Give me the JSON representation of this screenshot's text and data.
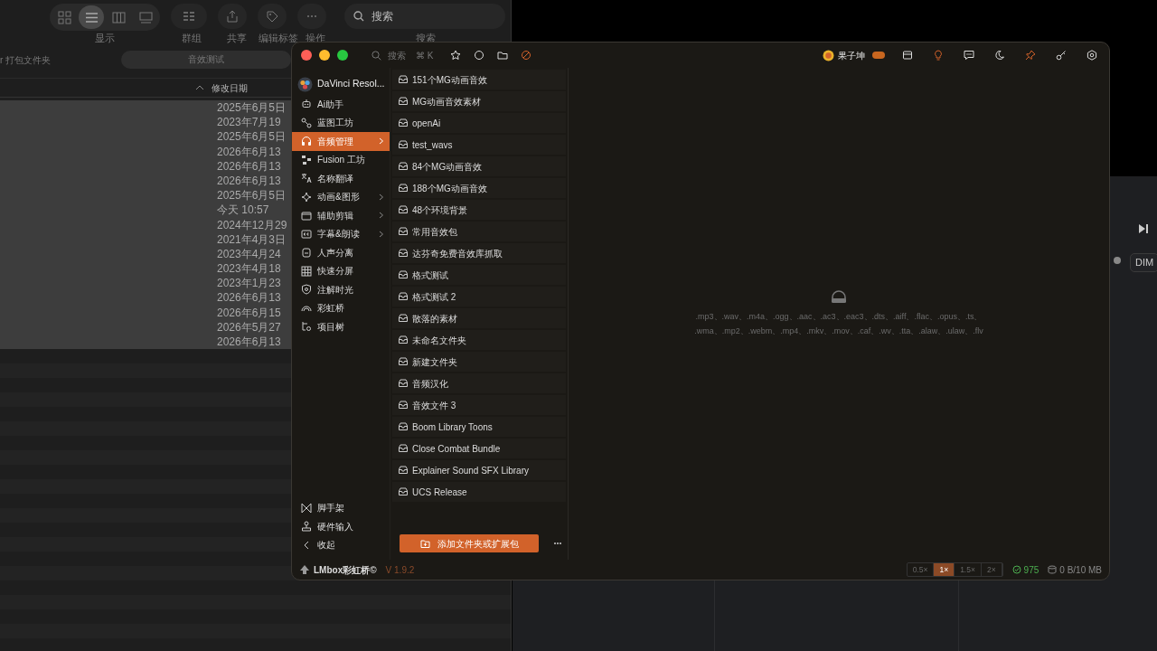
{
  "finder": {
    "view_modes": [
      {
        "selected": false
      },
      {
        "selected": true
      },
      {
        "selected": false
      },
      {
        "selected": false
      }
    ],
    "toolbar_labels": [
      "显示",
      "群组",
      "共享",
      "编辑标签",
      "操作"
    ],
    "search": {
      "placeholder": "搜索",
      "label": "搜索"
    },
    "path": {
      "crumb": "r 打包文件夹",
      "tab": "音效测试"
    },
    "column": "修改日期",
    "rows": [
      {
        "date": "2025年6月5日",
        "selected": true
      },
      {
        "date": "2023年7月19",
        "selected": true
      },
      {
        "date": "2025年6月5日",
        "selected": true
      },
      {
        "date": "2026年6月13",
        "selected": true
      },
      {
        "date": "2026年6月13",
        "selected": true
      },
      {
        "date": "2026年6月13",
        "selected": true
      },
      {
        "date": "2025年6月5日",
        "selected": true
      },
      {
        "date": "今天 10:57",
        "selected": true
      },
      {
        "date": "2024年12月29",
        "selected": true
      },
      {
        "date": "2021年4月3日",
        "selected": true
      },
      {
        "date": "2023年4月24",
        "selected": true
      },
      {
        "date": "2023年4月18",
        "selected": true
      },
      {
        "date": "2023年1月23",
        "selected": true
      },
      {
        "date": "2026年6月13",
        "selected": true
      },
      {
        "date": "2026年6月15",
        "selected": true
      },
      {
        "date": "2026年5月27",
        "selected": true
      },
      {
        "date": "2026年6月13",
        "selected": true
      }
    ]
  },
  "app": {
    "search": {
      "placeholder": "搜索",
      "shortcut": "⌘ K"
    },
    "user": {
      "name": "果子坤"
    },
    "project": "DaVinci Resol...",
    "sidebar": [
      {
        "label": "Ai助手",
        "selected": false,
        "submenu": false
      },
      {
        "label": "蓝图工坊",
        "selected": false,
        "submenu": false
      },
      {
        "label": "音频管理",
        "selected": true,
        "submenu": true
      },
      {
        "label": "Fusion 工坊",
        "selected": false,
        "submenu": false
      },
      {
        "label": "名称翻译",
        "selected": false,
        "submenu": false
      },
      {
        "label": "动画&图形",
        "selected": false,
        "submenu": true
      },
      {
        "label": "辅助剪辑",
        "selected": false,
        "submenu": true
      },
      {
        "label": "字幕&朗读",
        "selected": false,
        "submenu": true
      },
      {
        "label": "人声分离",
        "selected": false,
        "submenu": false
      },
      {
        "label": "快速分屏",
        "selected": false,
        "submenu": false
      },
      {
        "label": "注解时光",
        "selected": false,
        "submenu": false
      },
      {
        "label": "彩虹桥",
        "selected": false,
        "submenu": false
      },
      {
        "label": "项目树",
        "selected": false,
        "submenu": false
      }
    ],
    "sidebar_bottom": [
      "脚手架",
      "硬件输入",
      "收起"
    ],
    "folders": [
      "151个MG动画音效",
      "MG动画音效素材",
      "openAi",
      "test_wavs",
      "84个MG动画音效",
      "188个MG动画音效",
      "48个环境背景",
      "常用音效包",
      "达芬奇免费音效库抓取",
      "格式测试",
      "格式测试 2",
      "散落的素材",
      "未命名文件夹",
      "新建文件夹",
      "音频汉化",
      "音效文件 3",
      "Boom Library Toons",
      "Close Combat Bundle",
      "Explainer Sound SFX Library",
      "UCS Release"
    ],
    "add_button": "添加文件夹或扩展包",
    "formats": [
      ".mp3、.wav、.m4a、.ogg、.aac、.ac3、.eac3、.dts、.aiff、.flac、.opus、.ts、",
      ".wma、.mp2、.webm、.mp4、.mkv、.mov、.caf、.wv、.tta、.alaw、.ulaw、.flv"
    ],
    "status": {
      "brand": "LMbox彩虹桥©",
      "version": "V 1.9.2",
      "speeds": [
        {
          "label": "0.5×",
          "selected": false
        },
        {
          "label": "1×",
          "selected": true
        },
        {
          "label": "1.5×",
          "selected": false
        },
        {
          "label": "2×",
          "selected": false
        }
      ],
      "count": "975",
      "storage": "0 B/10 MB"
    }
  },
  "background_panel": {
    "button": "DIM"
  }
}
